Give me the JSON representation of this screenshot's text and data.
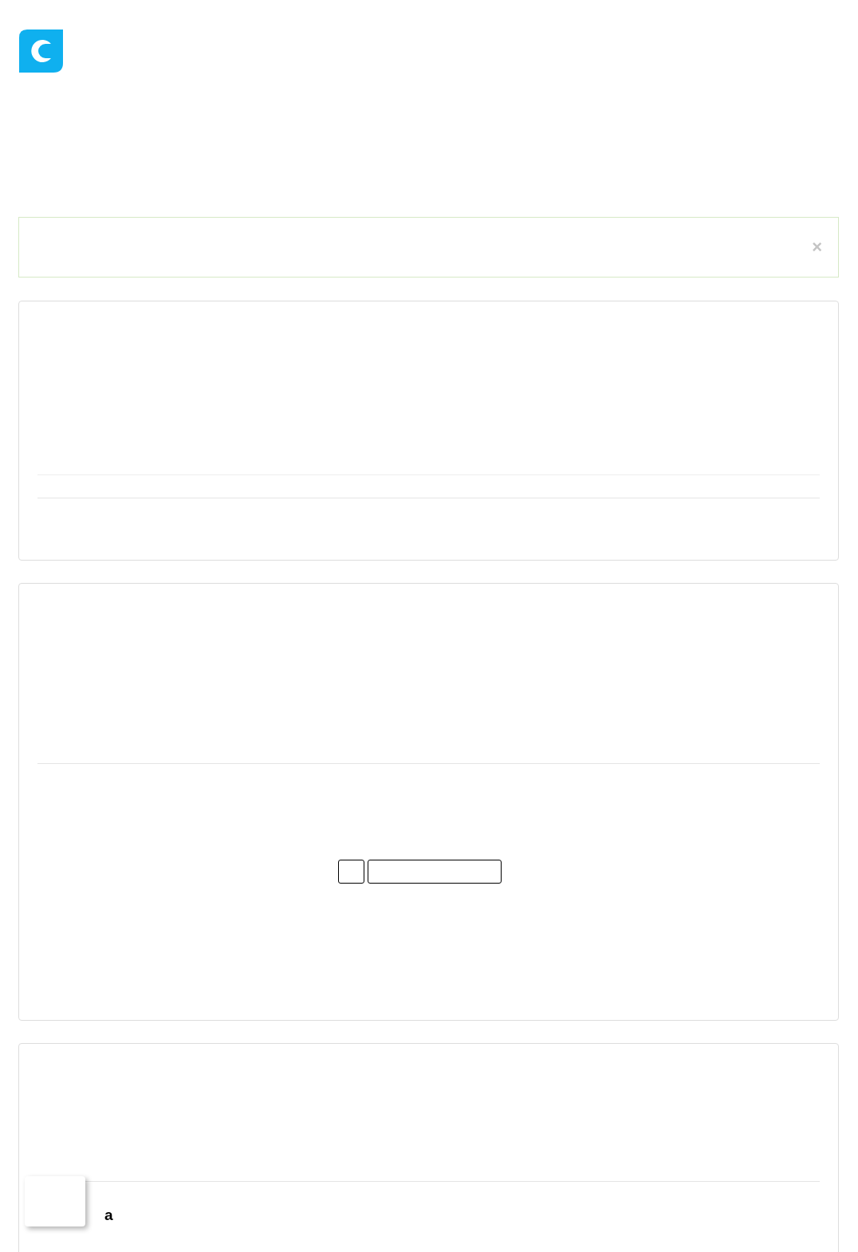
{
  "alert": {
    "close": "×"
  },
  "bottom_card": {
    "label": "a"
  }
}
